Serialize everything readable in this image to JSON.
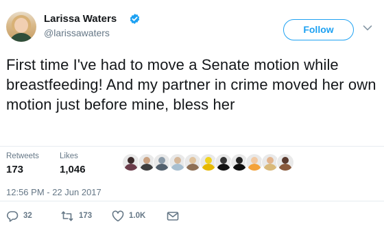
{
  "user": {
    "display_name": "Larissa Waters",
    "handle": "@larissawaters",
    "verified": true
  },
  "follow_button": {
    "label": "Follow"
  },
  "tweet": {
    "text": "First time I've had to move a Senate motion while breastfeeding! And my partner in crime moved her own motion just before mine, bless her",
    "timestamp": "12:56 PM - 22 Jun 2017"
  },
  "stats": {
    "retweets_label": "Retweets",
    "retweets_value": "173",
    "likes_label": "Likes",
    "likes_value": "1,046"
  },
  "likers": [
    {
      "icon": "liker-avatar",
      "head": "#3b2a2a",
      "body": "#6b3c4a"
    },
    {
      "icon": "liker-avatar",
      "head": "#c9a080",
      "body": "#3d3d3d"
    },
    {
      "icon": "liker-avatar",
      "head": "#8a9aa8",
      "body": "#52606d"
    },
    {
      "icon": "liker-avatar",
      "head": "#d4b79a",
      "body": "#a8bfd0"
    },
    {
      "icon": "liker-avatar",
      "head": "#e0c39d",
      "body": "#8e6f55"
    },
    {
      "icon": "liker-avatar",
      "head": "#f0d21f",
      "body": "#e6b800"
    },
    {
      "icon": "liker-avatar",
      "head": "#333333",
      "body": "#111111"
    },
    {
      "icon": "liker-avatar",
      "head": "#222222",
      "body": "#0f0f0f"
    },
    {
      "icon": "liker-avatar",
      "head": "#f2c9a2",
      "body": "#f4a23a"
    },
    {
      "icon": "liker-avatar",
      "head": "#e2b48d",
      "body": "#d9b97a"
    },
    {
      "icon": "liker-avatar",
      "head": "#5a3a2e",
      "body": "#8a5a3c"
    }
  ],
  "actions": {
    "reply_count": "32",
    "retweet_count": "173",
    "like_count": "1.0K"
  },
  "colors": {
    "accent": "#1da1f2",
    "secondary_text": "#657786",
    "primary_text": "#14171a",
    "divider": "#e6ecf0"
  }
}
